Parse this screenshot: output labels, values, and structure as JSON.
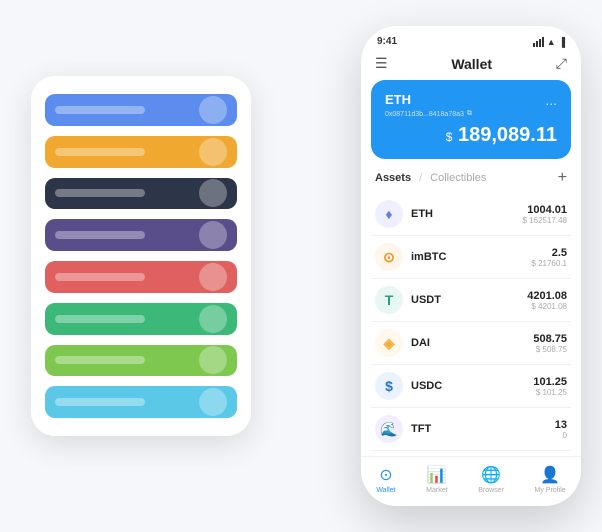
{
  "scene": {
    "bg_phone": {
      "cards": [
        {
          "id": "card-blue",
          "color": "#5b8cee",
          "icon": "◆"
        },
        {
          "id": "card-orange",
          "color": "#f0a830",
          "icon": "◆"
        },
        {
          "id": "card-dark",
          "color": "#2d3548",
          "icon": "⚙"
        },
        {
          "id": "card-purple",
          "color": "#5a4e8a",
          "icon": "◆"
        },
        {
          "id": "card-red",
          "color": "#e06060",
          "icon": "◆"
        },
        {
          "id": "card-green",
          "color": "#3cb878",
          "icon": "◆"
        },
        {
          "id": "card-light-green",
          "color": "#7ec850",
          "icon": "◆"
        },
        {
          "id": "card-light-blue",
          "color": "#5bc8e8",
          "icon": "◆"
        }
      ]
    },
    "fg_phone": {
      "status_bar": {
        "time": "9:41",
        "signal": "▌▌▌",
        "wifi": "WiFi",
        "battery": "🔋"
      },
      "header": {
        "menu_icon": "☰",
        "title": "Wallet",
        "expand_icon": "⤢"
      },
      "eth_card": {
        "label": "ETH",
        "more_icon": "...",
        "address": "0x08711d3b...8418a78a3",
        "copy_icon": "⧉",
        "dollar_sign": "$",
        "amount": "189,089.11"
      },
      "assets_header": {
        "tab_active": "Assets",
        "separator": "/",
        "tab_inactive": "Collectibles",
        "add_icon": "+"
      },
      "assets": [
        {
          "symbol": "ETH",
          "icon_char": "♦",
          "icon_color": "#627eea",
          "icon_bg": "#eef0ff",
          "amount": "1004.01",
          "usd": "$ 162517.48"
        },
        {
          "symbol": "imBTC",
          "icon_char": "⊙",
          "icon_color": "#f7931a",
          "icon_bg": "#fff5ea",
          "amount": "2.5",
          "usd": "$ 21760.1"
        },
        {
          "symbol": "USDT",
          "icon_char": "T",
          "icon_color": "#26a17b",
          "icon_bg": "#e8f7f3",
          "amount": "4201.08",
          "usd": "$ 4201.08"
        },
        {
          "symbol": "DAI",
          "icon_char": "◈",
          "icon_color": "#f5ac37",
          "icon_bg": "#fff8ec",
          "amount": "508.75",
          "usd": "$ 508.75"
        },
        {
          "symbol": "USDC",
          "icon_char": "$",
          "icon_color": "#2775ca",
          "icon_bg": "#eaf2fd",
          "amount": "101.25",
          "usd": "$ 101.25"
        },
        {
          "symbol": "TFT",
          "icon_char": "🌊",
          "icon_color": "#7b5ea7",
          "icon_bg": "#f3eeff",
          "amount": "13",
          "usd": "0"
        }
      ],
      "nav": [
        {
          "id": "wallet",
          "icon": "⊙",
          "label": "Wallet",
          "active": true
        },
        {
          "id": "market",
          "icon": "📊",
          "label": "Market",
          "active": false
        },
        {
          "id": "browser",
          "icon": "🌐",
          "label": "Browser",
          "active": false
        },
        {
          "id": "profile",
          "icon": "👤",
          "label": "My Profile",
          "active": false
        }
      ]
    }
  }
}
